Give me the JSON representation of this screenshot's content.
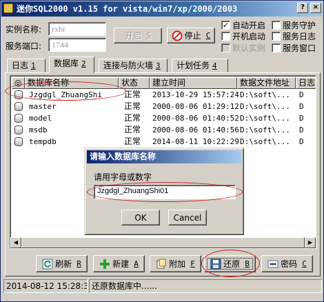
{
  "window": {
    "title": "迷你SQL2000 v1.15 for vista/win7/xp/2000/2003"
  },
  "title_buttons": {
    "help": "?",
    "close": "×"
  },
  "config": {
    "instance_label": "实例名称:",
    "instance_value": "rxhr",
    "port_label": "服务端口:",
    "port_value": "1744"
  },
  "service_buttons": {
    "start_label": "开启",
    "start_key": "S",
    "stop_label": "停止",
    "stop_key": "C"
  },
  "options": {
    "auto_start": "自动开启",
    "boot_start": "开机启动",
    "default_instance": "默认实例",
    "service_guard": "服务守护",
    "service_log": "服务日志",
    "service_window": "服务窗口",
    "check_mark": "✓"
  },
  "tabs": [
    {
      "label": "日志",
      "key": "1"
    },
    {
      "label": "数据库",
      "key": "2"
    },
    {
      "label": "连接与防火墙",
      "key": "3"
    },
    {
      "label": "计划任务",
      "key": "4"
    }
  ],
  "table": {
    "columns": [
      "◎",
      "数据库名称",
      "状态",
      "建立时间",
      "数据文件地址",
      "日志"
    ],
    "rows": [
      {
        "name": "Jzgdgl_ZhuangShi",
        "status": "正常",
        "created": "2013-10-29 15:57:24",
        "path": "D:\\soft\\..."
      },
      {
        "name": "master",
        "status": "正常",
        "created": "2000-08-06 01:29:12",
        "path": "D:\\soft\\..."
      },
      {
        "name": "model",
        "status": "正常",
        "created": "2000-08-06 01:40:52",
        "path": "D:\\soft\\..."
      },
      {
        "name": "msdb",
        "status": "正常",
        "created": "2000-08-06 01:40:56",
        "path": "D:\\soft\\..."
      },
      {
        "name": "tempdb",
        "status": "正常",
        "created": "2014-08-11 10:22:29",
        "path": "D:\\soft\\..."
      }
    ],
    "log_col": [
      "D",
      "D",
      "D",
      "D",
      "D"
    ]
  },
  "scroll": {
    "left_arrow": "◀",
    "right_arrow": "▶"
  },
  "actions": [
    {
      "label": "刷新",
      "key": "R"
    },
    {
      "label": "新建",
      "key": "A"
    },
    {
      "label": "附加",
      "key": "F"
    },
    {
      "label": "还原",
      "key": "B"
    },
    {
      "label": "密码",
      "key": "C"
    }
  ],
  "status": {
    "time": "2014-08-12 15:28:30",
    "message": "还原数据库中......"
  },
  "dialog": {
    "title": "请输入数据库名称",
    "prompt": "请用字母或数字",
    "input_value": "Jzgdgl_ZhuangShi01",
    "ok_label": "OK",
    "cancel_label": "Cancel"
  },
  "colors": {
    "annotation": "#d21e1e",
    "title_bar": "#0a246a"
  }
}
